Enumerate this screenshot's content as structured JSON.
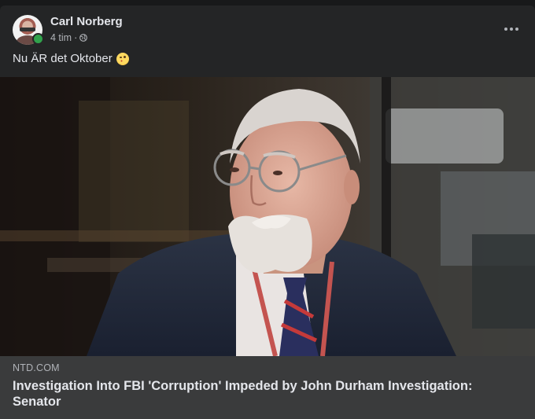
{
  "post": {
    "author": "Carl Norberg",
    "time": "4 tim",
    "separator": "·",
    "privacy_icon": "globe-icon",
    "text": "Nu ÄR det Oktober",
    "text_emoji": "winking-face-with-tongue-emoji",
    "more_icon": "more-options-icon"
  },
  "link": {
    "domain": "NTD.COM",
    "title": "Investigation Into FBI 'Corruption' Impeded by John Durham Investigation: Senator",
    "image_icon": "news-photo"
  },
  "colors": {
    "card_bg": "#242526",
    "link_info_bg": "#3a3b3c",
    "primary_text": "#e4e6eb",
    "secondary_text": "#b0b3b8",
    "online": "#31a24c"
  }
}
